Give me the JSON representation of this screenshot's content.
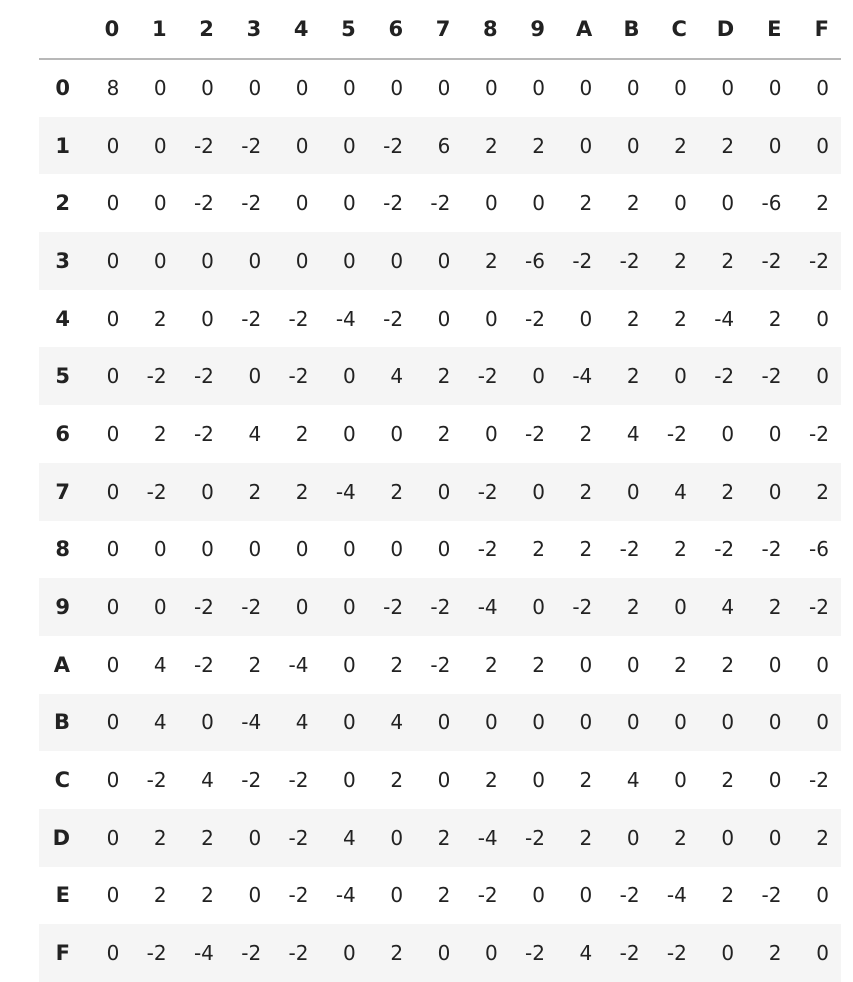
{
  "columns": [
    "0",
    "1",
    "2",
    "3",
    "4",
    "5",
    "6",
    "7",
    "8",
    "9",
    "A",
    "B",
    "C",
    "D",
    "E",
    "F"
  ],
  "rows": [
    {
      "label": "0",
      "values": [
        "8",
        "0",
        "0",
        "0",
        "0",
        "0",
        "0",
        "0",
        "0",
        "0",
        "0",
        "0",
        "0",
        "0",
        "0",
        "0"
      ]
    },
    {
      "label": "1",
      "values": [
        "0",
        "0",
        "-2",
        "-2",
        "0",
        "0",
        "-2",
        "6",
        "2",
        "2",
        "0",
        "0",
        "2",
        "2",
        "0",
        "0"
      ]
    },
    {
      "label": "2",
      "values": [
        "0",
        "0",
        "-2",
        "-2",
        "0",
        "0",
        "-2",
        "-2",
        "0",
        "0",
        "2",
        "2",
        "0",
        "0",
        "-6",
        "2"
      ]
    },
    {
      "label": "3",
      "values": [
        "0",
        "0",
        "0",
        "0",
        "0",
        "0",
        "0",
        "0",
        "2",
        "-6",
        "-2",
        "-2",
        "2",
        "2",
        "-2",
        "-2"
      ]
    },
    {
      "label": "4",
      "values": [
        "0",
        "2",
        "0",
        "-2",
        "-2",
        "-4",
        "-2",
        "0",
        "0",
        "-2",
        "0",
        "2",
        "2",
        "-4",
        "2",
        "0"
      ]
    },
    {
      "label": "5",
      "values": [
        "0",
        "-2",
        "-2",
        "0",
        "-2",
        "0",
        "4",
        "2",
        "-2",
        "0",
        "-4",
        "2",
        "0",
        "-2",
        "-2",
        "0"
      ]
    },
    {
      "label": "6",
      "values": [
        "0",
        "2",
        "-2",
        "4",
        "2",
        "0",
        "0",
        "2",
        "0",
        "-2",
        "2",
        "4",
        "-2",
        "0",
        "0",
        "-2"
      ]
    },
    {
      "label": "7",
      "values": [
        "0",
        "-2",
        "0",
        "2",
        "2",
        "-4",
        "2",
        "0",
        "-2",
        "0",
        "2",
        "0",
        "4",
        "2",
        "0",
        "2"
      ]
    },
    {
      "label": "8",
      "values": [
        "0",
        "0",
        "0",
        "0",
        "0",
        "0",
        "0",
        "0",
        "-2",
        "2",
        "2",
        "-2",
        "2",
        "-2",
        "-2",
        "-6"
      ]
    },
    {
      "label": "9",
      "values": [
        "0",
        "0",
        "-2",
        "-2",
        "0",
        "0",
        "-2",
        "-2",
        "-4",
        "0",
        "-2",
        "2",
        "0",
        "4",
        "2",
        "-2"
      ]
    },
    {
      "label": "A",
      "values": [
        "0",
        "4",
        "-2",
        "2",
        "-4",
        "0",
        "2",
        "-2",
        "2",
        "2",
        "0",
        "0",
        "2",
        "2",
        "0",
        "0"
      ]
    },
    {
      "label": "B",
      "values": [
        "0",
        "4",
        "0",
        "-4",
        "4",
        "0",
        "4",
        "0",
        "0",
        "0",
        "0",
        "0",
        "0",
        "0",
        "0",
        "0"
      ]
    },
    {
      "label": "C",
      "values": [
        "0",
        "-2",
        "4",
        "-2",
        "-2",
        "0",
        "2",
        "0",
        "2",
        "0",
        "2",
        "4",
        "0",
        "2",
        "0",
        "-2"
      ]
    },
    {
      "label": "D",
      "values": [
        "0",
        "2",
        "2",
        "0",
        "-2",
        "4",
        "0",
        "2",
        "-4",
        "-2",
        "2",
        "0",
        "2",
        "0",
        "0",
        "2"
      ]
    },
    {
      "label": "E",
      "values": [
        "0",
        "2",
        "2",
        "0",
        "-2",
        "-4",
        "0",
        "2",
        "-2",
        "0",
        "0",
        "-2",
        "-4",
        "2",
        "-2",
        "0"
      ]
    },
    {
      "label": "F",
      "values": [
        "0",
        "-2",
        "-4",
        "-2",
        "-2",
        "0",
        "2",
        "0",
        "0",
        "-2",
        "4",
        "-2",
        "-2",
        "0",
        "2",
        "0"
      ]
    }
  ]
}
